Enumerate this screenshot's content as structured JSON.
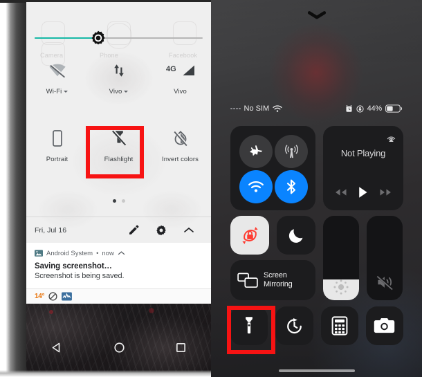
{
  "android": {
    "brightness": {
      "name": "brightness-slider",
      "fill_percent": 38,
      "fill_color": "#16b8a6",
      "icon": "brightness-gear-icon"
    },
    "ghost_labels": {
      "l1": "Camera",
      "l2": "Phone",
      "l3": "Facebook"
    },
    "quick_settings_row1": [
      {
        "label": "Wi-Fi",
        "icon": "wifi-off-icon",
        "has_caret": true,
        "state": "off"
      },
      {
        "label": "Vivo",
        "icon": "mobile-data-icon",
        "has_caret": true,
        "state": "on"
      },
      {
        "label": "Vivo",
        "icon": "signal-4g-icon",
        "has_caret": false,
        "state": "on"
      }
    ],
    "quick_settings_row2": [
      {
        "label": "Portrait",
        "icon": "rotation-portrait-icon",
        "has_caret": false,
        "state": "off"
      },
      {
        "label": "Flashlight",
        "icon": "flashlight-off-icon",
        "has_caret": false,
        "state": "off",
        "highlighted": true
      },
      {
        "label": "Invert colors",
        "icon": "invert-colors-off-icon",
        "has_caret": false,
        "state": "off"
      }
    ],
    "page_dots": {
      "total": 2,
      "active_index": 0
    },
    "footer": {
      "date": "Fri, Jul 16",
      "edit_icon": "pencil-icon",
      "settings_icon": "gear-icon",
      "collapse_icon": "chevron-up-icon"
    },
    "notification": {
      "app_icon": "image-icon",
      "app_name": "Android System",
      "separator": "•",
      "time": "now",
      "expand_icon": "chevron-up-icon",
      "title": "Saving screenshot…",
      "body": "Screenshot is being saved."
    },
    "status_strip": {
      "temperature": "14°",
      "icons": [
        "do-not-disturb-icon",
        "stocks-chart-icon"
      ],
      "temp_color": "#e8730a"
    },
    "nav_bar": [
      {
        "name": "back-button",
        "icon": "triangle-back-icon"
      },
      {
        "name": "home-button",
        "icon": "circle-home-icon"
      },
      {
        "name": "recents-button",
        "icon": "square-recents-icon"
      }
    ]
  },
  "ios": {
    "grabber_icon": "chevron-down-grabber-icon",
    "status_bar": {
      "signal_icon": "signal-dots-icon",
      "carrier": "No SIM",
      "wifi_icon": "wifi-icon",
      "alarm_icon": "alarm-clock-icon",
      "rotation_lock_icon": "rotation-lock-icon",
      "battery_percent": "44%",
      "battery_icon": "battery-icon",
      "battery_level": 44
    },
    "connectivity": [
      {
        "name": "airplane-mode-button",
        "icon": "airplane-icon",
        "state": "off"
      },
      {
        "name": "cellular-data-button",
        "icon": "cellular-antenna-icon",
        "state": "off"
      },
      {
        "name": "wifi-button",
        "icon": "wifi-icon",
        "state": "on"
      },
      {
        "name": "bluetooth-button",
        "icon": "bluetooth-icon",
        "state": "on"
      }
    ],
    "media": {
      "airplay_icon": "airplay-audio-icon",
      "title": "Not Playing",
      "prev_icon": "rewind-icon",
      "play_icon": "play-icon",
      "next_icon": "fast-forward-icon"
    },
    "rotation_lock": {
      "name": "rotation-lock-button",
      "icon": "rotation-lock-icon",
      "state": "on",
      "accent": "#ff3b30"
    },
    "do_not_disturb": {
      "name": "do-not-disturb-button",
      "icon": "moon-icon",
      "state": "off"
    },
    "screen_mirroring": {
      "name": "screen-mirroring-button",
      "icon": "screen-mirroring-icon",
      "label_line1": "Screen",
      "label_line2": "Mirroring"
    },
    "brightness_slider": {
      "name": "brightness-slider",
      "icon": "brightness-sun-icon",
      "fill_percent": 25
    },
    "volume_slider": {
      "name": "volume-slider",
      "icon": "volume-muted-icon",
      "fill_percent": 0
    },
    "shortcuts": [
      {
        "name": "flashlight-button",
        "icon": "flashlight-icon",
        "highlighted": true
      },
      {
        "name": "timer-button",
        "icon": "timer-icon",
        "highlighted": false
      },
      {
        "name": "calculator-button",
        "icon": "calculator-icon",
        "highlighted": false
      },
      {
        "name": "camera-button",
        "icon": "camera-icon",
        "highlighted": false
      }
    ]
  },
  "highlight": {
    "color": "#f71313",
    "targets": [
      "android-flashlight-tile",
      "ios-flashlight-button"
    ]
  }
}
